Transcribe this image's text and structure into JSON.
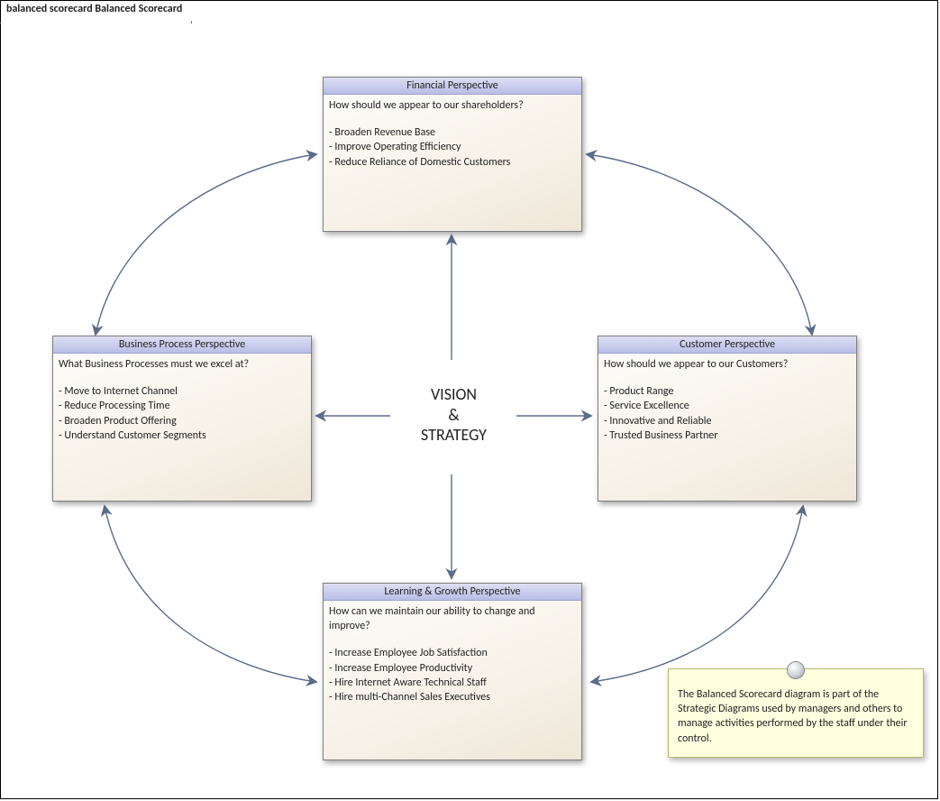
{
  "frame": {
    "title": "balanced scorecard Balanced Scorecard"
  },
  "center": {
    "line1": "VISION",
    "line2": "&",
    "line3": "STRATEGY"
  },
  "financial": {
    "title": "Financial Perspective",
    "question": "How should we appear to our shareholders?",
    "b1": "- Broaden Revenue Base",
    "b2": "- Improve Operating Efficiency",
    "b3": "- Reduce Reliance of Domestic Customers"
  },
  "business": {
    "title": "Business Process Perspective",
    "question": "What Business Processes must we excel at?",
    "b1": "- Move to Internet Channel",
    "b2": "- Reduce Processing Time",
    "b3": "- Broaden Product Offering",
    "b4": "- Understand Customer Segments"
  },
  "customer": {
    "title": "Customer Perspective",
    "question": "How should we appear to our Customers?",
    "b1": "- Product Range",
    "b2": "- Service Excellence",
    "b3": "- Innovative and Reliable",
    "b4": "- Trusted Business Partner"
  },
  "learning": {
    "title": "Learning & Growth Perspective",
    "question": "How can we maintain our ability to change and improve?",
    "b1": "- Increase Employee Job Satisfaction",
    "b2": "- Increase Employee Productivity",
    "b3": "- Hire Internet Aware Technical Staff",
    "b4": "- Hire multi-Channel Sales Executives"
  },
  "note": {
    "text": "The Balanced Scorecard diagram is part of the Strategic Diagrams used by managers and others to manage activities performed by the staff under their control."
  }
}
